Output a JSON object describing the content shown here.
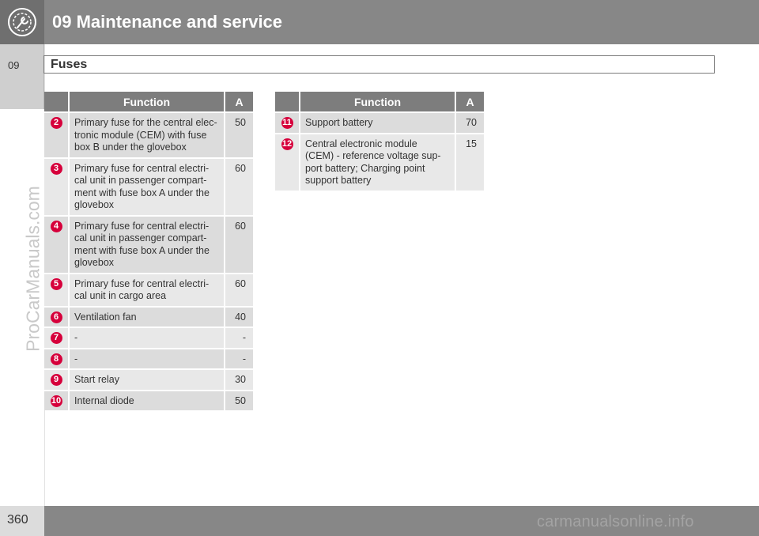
{
  "header": {
    "title": "09 Maintenance and service",
    "icon": "wrench-gear-icon"
  },
  "side": {
    "chapter": "09",
    "watermark": "ProCarManuals.com"
  },
  "section": {
    "title": "Fuses"
  },
  "tables": {
    "left": {
      "headers": {
        "num": "",
        "function": "Function",
        "amp": "A"
      },
      "rows": [
        {
          "num": "2",
          "function": "Primary fuse for the central elec-\ntronic module (CEM) with fuse\nbox B under the glovebox",
          "amp": "50"
        },
        {
          "num": "3",
          "function": "Primary fuse for central electri-\ncal unit in passenger compart-\nment with fuse box A under the\nglovebox",
          "amp": "60"
        },
        {
          "num": "4",
          "function": "Primary fuse for central electri-\ncal unit in passenger compart-\nment with fuse box A under the\nglovebox",
          "amp": "60"
        },
        {
          "num": "5",
          "function": "Primary fuse for central electri-\ncal unit in cargo area",
          "amp": "60"
        },
        {
          "num": "6",
          "function": "Ventilation fan",
          "amp": "40"
        },
        {
          "num": "7",
          "function": "-",
          "amp": "-"
        },
        {
          "num": "8",
          "function": "-",
          "amp": "-"
        },
        {
          "num": "9",
          "function": "Start relay",
          "amp": "30"
        },
        {
          "num": "10",
          "function": "Internal diode",
          "amp": "50"
        }
      ]
    },
    "right": {
      "headers": {
        "num": "",
        "function": "Function",
        "amp": "A"
      },
      "rows": [
        {
          "num": "11",
          "function": "Support battery",
          "amp": "70"
        },
        {
          "num": "12",
          "function": "Central electronic module\n(CEM) - reference voltage sup-\nport battery; Charging point\nsupport battery",
          "amp": "15"
        }
      ]
    }
  },
  "footer": {
    "page": "360",
    "watermark": "carmanualsonline.info"
  },
  "colors": {
    "header": "#878787",
    "badge": "#d6003b",
    "row": "#dcdcdc",
    "row_alt": "#e8e8e8"
  }
}
